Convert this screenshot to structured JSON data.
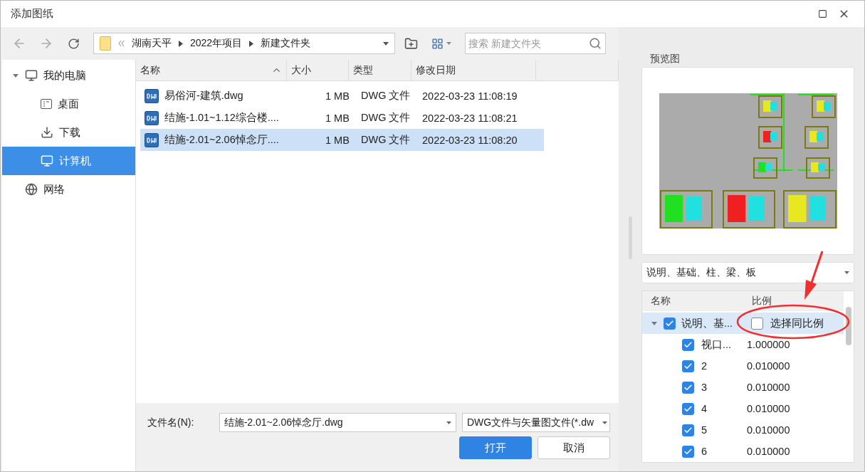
{
  "window": {
    "title": "添加图纸"
  },
  "toolbar": {
    "breadcrumb": [
      "湖南天平",
      "2022年项目",
      "新建文件夹"
    ],
    "search": {
      "placeholder": "搜索 新建文件夹"
    }
  },
  "sidebar": {
    "items": [
      {
        "label": "我的电脑",
        "kind": "monitor",
        "selected": false,
        "expanded": true,
        "children": [
          {
            "label": "桌面",
            "kind": "desktop",
            "selected": false
          },
          {
            "label": "下载",
            "kind": "download",
            "selected": false
          },
          {
            "label": "计算机",
            "kind": "monitor",
            "selected": true
          }
        ]
      },
      {
        "label": "网络",
        "kind": "globe",
        "selected": false
      }
    ]
  },
  "file_list": {
    "columns": [
      "名称",
      "大小",
      "类型",
      "修改日期"
    ],
    "rows": [
      {
        "name": "易俗河-建筑.dwg",
        "size": "1 MB",
        "type": "DWG 文件",
        "date": "2022-03-23 11:08:19",
        "selected": false
      },
      {
        "name": "结施-1.01~1.12综合楼....",
        "size": "1 MB",
        "type": "DWG 文件",
        "date": "2022-03-23 11:08:21",
        "selected": false
      },
      {
        "name": "结施-2.01~2.06悼念厅....",
        "size": "1 MB",
        "type": "DWG 文件",
        "date": "2022-03-23 11:08:20",
        "selected": true
      }
    ]
  },
  "footer": {
    "filename_label": "文件名(N):",
    "filename": "结施-2.01~2.06悼念厅.dwg",
    "filetype": "DWG文件与矢量图文件(*.dw",
    "buttons": [
      {
        "label": "打开",
        "kind": "primary"
      },
      {
        "label": "取消",
        "kind": "secondary"
      }
    ]
  },
  "preview": {
    "label": "预览图",
    "layer_select": "说明、基础、柱、梁、板"
  },
  "layer_tree": {
    "columns": [
      "名称",
      "比例"
    ],
    "root": {
      "label": "说明、基...",
      "checked": true,
      "expanded": true,
      "selected": true,
      "same_scale": {
        "label": "选择同比例",
        "checked": false
      },
      "children": [
        {
          "label": "视口...",
          "scale": "1.000000",
          "checked": true
        },
        {
          "label": "2",
          "scale": "0.010000",
          "checked": true
        },
        {
          "label": "3",
          "scale": "0.010000",
          "checked": true
        },
        {
          "label": "4",
          "scale": "0.010000",
          "checked": true
        },
        {
          "label": "5",
          "scale": "0.010000",
          "checked": true
        },
        {
          "label": "6",
          "scale": "0.010000",
          "checked": true
        }
      ]
    }
  }
}
